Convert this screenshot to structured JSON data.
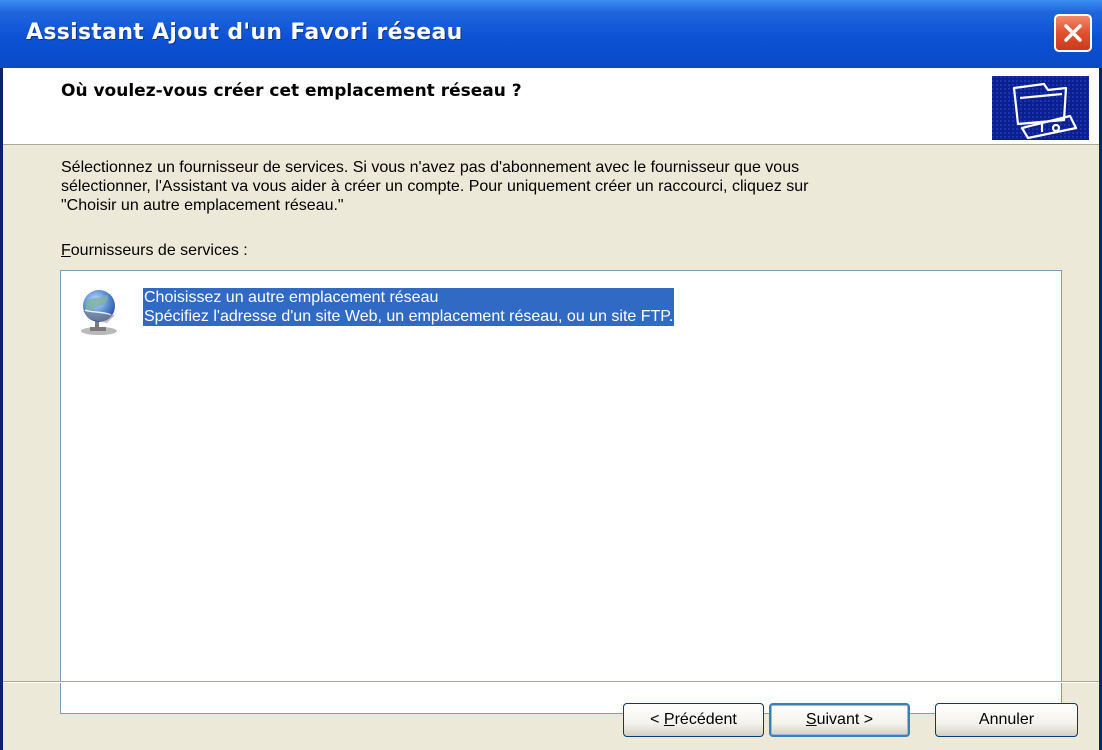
{
  "window": {
    "title": "Assistant Ajout d'un Favori réseau"
  },
  "header": {
    "title": "Où voulez-vous créer cet emplacement réseau ?",
    "icon": "network-folder-icon"
  },
  "content": {
    "description_lines": [
      "Sélectionnez un fournisseur de services. Si vous n'avez pas d'abonnement avec le fournisseur que vous",
      "sélectionner, l'Assistant va vous aider à créer un compte. Pour uniquement créer un raccourci, cliquez sur",
      "\"Choisir un autre emplacement réseau.\""
    ],
    "providers_label_mnemonic": "F",
    "providers_label_rest": "ournisseurs de services :",
    "providers": [
      {
        "title": "Choisissez un autre emplacement réseau",
        "subtitle": "Spécifiez l'adresse d'un site Web, un emplacement réseau, ou un site FTP.",
        "icon": "network-globe-icon",
        "selected": true
      }
    ]
  },
  "buttons": {
    "back_prefix": "< ",
    "back_mnemonic": "P",
    "back_rest": "récédent",
    "next_mnemonic": "S",
    "next_rest": "uivant >",
    "cancel": "Annuler"
  },
  "colors": {
    "titlebar": "#0a49c4",
    "selection": "#316ac5",
    "dialog_bg": "#ece9d8",
    "close_button": "#e2502e"
  }
}
